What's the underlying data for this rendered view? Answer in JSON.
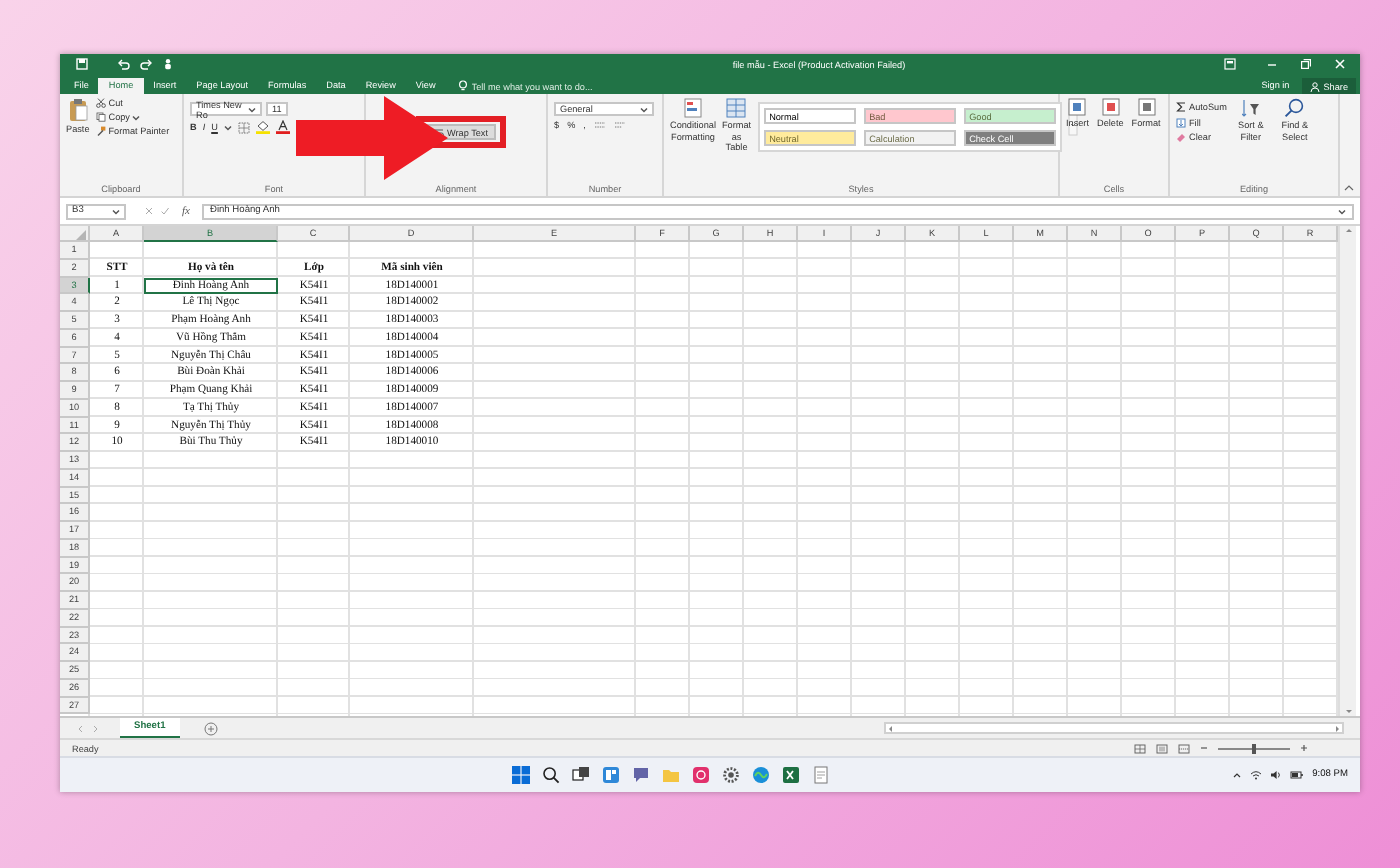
{
  "window": {
    "title": "file mẫu - Excel (Product Activation Failed)",
    "sign_in": "Sign in",
    "share": "Share"
  },
  "tabs": [
    {
      "label": "File",
      "selected": false
    },
    {
      "label": "Home",
      "selected": true
    },
    {
      "label": "Insert",
      "selected": false
    },
    {
      "label": "Page Layout",
      "selected": false
    },
    {
      "label": "Formulas",
      "selected": false
    },
    {
      "label": "Data",
      "selected": false
    },
    {
      "label": "Review",
      "selected": false
    },
    {
      "label": "View",
      "selected": false
    }
  ],
  "tell_me": {
    "placeholder": "Tell me what you want to do..."
  },
  "ribbon": {
    "clipboard": {
      "label": "Clipboard",
      "paste": "Paste",
      "cut": "Cut",
      "copy": "Copy",
      "format_painter": "Format Painter"
    },
    "font": {
      "label": "Font",
      "font_name": "Times New Ro",
      "font_size": "11",
      "bold": "B",
      "italic": "I",
      "underline": "U"
    },
    "alignment": {
      "label": "Alignment",
      "wrap_text": "Wrap Text"
    },
    "number": {
      "label": "Number",
      "format": "General",
      "currency": "$",
      "percent": "%",
      "comma": ","
    },
    "styles": {
      "label": "Styles",
      "conditional_formatting": "Conditional Formatting",
      "format_as_table": "Format as Table",
      "cell_styles": [
        {
          "label": "Normal",
          "color": "#ffffff"
        },
        {
          "label": "Bad",
          "color": "#ffc7ce"
        },
        {
          "label": "Good",
          "color": "#c6efce"
        },
        {
          "label": "Neutral",
          "color": "#ffeb9c"
        },
        {
          "label": "Calculation",
          "color": "#f2f2f2"
        },
        {
          "label": "Check Cell",
          "color": "#7f7f7f"
        }
      ]
    },
    "cells": {
      "label": "Cells",
      "insert": "Insert",
      "delete": "Delete",
      "format": "Format"
    },
    "editing": {
      "label": "Editing",
      "autosum": "AutoSum",
      "fill": "Fill",
      "clear": "Clear",
      "sort_filter": "Sort & Filter",
      "find_select": "Find & Select"
    }
  },
  "formula_bar": {
    "name_box": "B3",
    "function_label": "fx",
    "value": "Đinh Hoàng Anh"
  },
  "sheet": {
    "columns": [
      "A",
      "B",
      "C",
      "D",
      "E",
      "F",
      "G",
      "H",
      "I",
      "J",
      "K",
      "L",
      "M",
      "N",
      "O",
      "P",
      "Q",
      "R"
    ],
    "rows": [
      {
        "number": "1"
      },
      {
        "number": "2",
        "kind": "header",
        "cells": [
          {
            "text": "STT",
            "selected": false
          },
          {
            "text": "Họ và tên",
            "selected": false
          },
          {
            "text": "Lớp",
            "selected": false
          },
          {
            "text": "Mã sinh viên",
            "selected": false
          }
        ]
      },
      {
        "number": "3",
        "kind": "data",
        "cells": [
          {
            "text": "1",
            "selected": false
          },
          {
            "text": "Đinh Hoàng Anh",
            "selected": true
          },
          {
            "text": "K54I1",
            "selected": false
          },
          {
            "text": "18D140001",
            "selected": false
          }
        ]
      },
      {
        "number": "4",
        "kind": "data",
        "cells": [
          {
            "text": "2",
            "selected": false
          },
          {
            "text": "Lê Thị Ngọc",
            "selected": false
          },
          {
            "text": "K54I1",
            "selected": false
          },
          {
            "text": "18D140002",
            "selected": false
          }
        ]
      },
      {
        "number": "5",
        "kind": "data",
        "cells": [
          {
            "text": "3",
            "selected": false
          },
          {
            "text": "Phạm Hoàng Anh",
            "selected": false
          },
          {
            "text": "K54I1",
            "selected": false
          },
          {
            "text": "18D140003",
            "selected": false
          }
        ]
      },
      {
        "number": "6",
        "kind": "data",
        "cells": [
          {
            "text": "4",
            "selected": false
          },
          {
            "text": "Vũ Hồng Thắm",
            "selected": false
          },
          {
            "text": "K54I1",
            "selected": false
          },
          {
            "text": "18D140004",
            "selected": false
          }
        ]
      },
      {
        "number": "7",
        "kind": "data",
        "cells": [
          {
            "text": "5",
            "selected": false
          },
          {
            "text": "Nguyễn Thị Châu",
            "selected": false
          },
          {
            "text": "K54I1",
            "selected": false
          },
          {
            "text": "18D140005",
            "selected": false
          }
        ]
      },
      {
        "number": "8",
        "kind": "data",
        "cells": [
          {
            "text": "6",
            "selected": false
          },
          {
            "text": "Bùi Đoàn Khải",
            "selected": false
          },
          {
            "text": "K54I1",
            "selected": false
          },
          {
            "text": "18D140006",
            "selected": false
          }
        ]
      },
      {
        "number": "9",
        "kind": "data",
        "cells": [
          {
            "text": "7",
            "selected": false
          },
          {
            "text": "Phạm Quang Khải",
            "selected": false
          },
          {
            "text": "K54I1",
            "selected": false
          },
          {
            "text": "18D140009",
            "selected": false
          }
        ]
      },
      {
        "number": "10",
        "kind": "data",
        "cells": [
          {
            "text": "8",
            "selected": false
          },
          {
            "text": "Tạ Thị Thủy",
            "selected": false
          },
          {
            "text": "K54I1",
            "selected": false
          },
          {
            "text": "18D140007",
            "selected": false
          }
        ]
      },
      {
        "number": "11",
        "kind": "data",
        "cells": [
          {
            "text": "9",
            "selected": false
          },
          {
            "text": "Nguyễn Thị Thủy",
            "selected": false
          },
          {
            "text": "K54I1",
            "selected": false
          },
          {
            "text": "18D140008",
            "selected": false
          }
        ]
      },
      {
        "number": "12",
        "kind": "data",
        "cells": [
          {
            "text": "10",
            "selected": false
          },
          {
            "text": "Bùi Thu Thủy",
            "selected": false
          },
          {
            "text": "K54I1",
            "selected": false
          },
          {
            "text": "18D140010",
            "selected": false
          }
        ]
      },
      {
        "number": "13"
      },
      {
        "number": "14"
      },
      {
        "number": "15"
      },
      {
        "number": "16"
      },
      {
        "number": "17"
      },
      {
        "number": "18"
      },
      {
        "number": "19"
      },
      {
        "number": "20"
      },
      {
        "number": "21"
      },
      {
        "number": "22"
      },
      {
        "number": "23"
      },
      {
        "number": "24"
      },
      {
        "number": "25"
      },
      {
        "number": "26"
      },
      {
        "number": "27"
      }
    ]
  },
  "sheet_tabs": [
    {
      "label": "Sheet1",
      "selected": true
    }
  ],
  "status_bar": {
    "status": "Ready",
    "zoom_slider": {
      "level": 0.5
    }
  },
  "taskbar": {
    "time": "9:08 PM"
  }
}
